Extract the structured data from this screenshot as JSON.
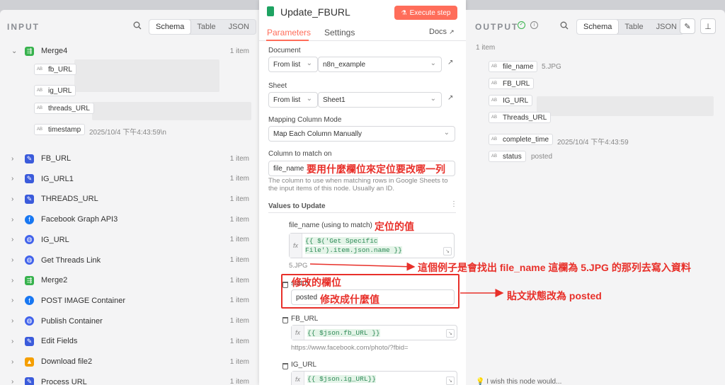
{
  "left": {
    "title": "INPUT",
    "tabs": [
      "Schema",
      "Table",
      "JSON"
    ],
    "merge4": {
      "label": "Merge4",
      "count": "1 item"
    },
    "fields": [
      {
        "name": "fb_URL",
        "value": ""
      },
      {
        "name": "ig_URL",
        "value": ""
      },
      {
        "name": "threads_URL",
        "value": ""
      },
      {
        "name": "timestamp",
        "value": "2025/10/4 下午4:43:59\\n"
      }
    ],
    "nodes": [
      {
        "label": "FB_URL",
        "count": "1 item",
        "icon": "pencil-icon",
        "color": "#3b5bdb"
      },
      {
        "label": "IG_URL1",
        "count": "1 item",
        "icon": "pencil-icon",
        "color": "#3b5bdb"
      },
      {
        "label": "THREADS_URL",
        "count": "1 item",
        "icon": "pencil-icon",
        "color": "#3b5bdb"
      },
      {
        "label": "Facebook Graph API3",
        "count": "1 item",
        "icon": "facebook-icon",
        "color": "#1877f2"
      },
      {
        "label": "IG_URL",
        "count": "1 item",
        "icon": "globe-icon",
        "color": "#4263eb"
      },
      {
        "label": "Get Threads Link",
        "count": "1 item",
        "icon": "globe-icon",
        "color": "#4263eb"
      },
      {
        "label": "Merge2",
        "count": "1 item",
        "icon": "merge-icon",
        "color": "#37b24d"
      },
      {
        "label": "POST IMAGE Container",
        "count": "1 item",
        "icon": "facebook-icon",
        "color": "#1877f2"
      },
      {
        "label": "Publish Container",
        "count": "1 item",
        "icon": "globe-icon",
        "color": "#4263eb"
      },
      {
        "label": "Edit Fields",
        "count": "1 item",
        "icon": "pencil-icon",
        "color": "#3b5bdb"
      },
      {
        "label": "Download file2",
        "count": "1 item",
        "icon": "google-drive-icon",
        "color": "#f59f00"
      },
      {
        "label": "Process URL",
        "count": "1 item",
        "icon": "pencil-icon",
        "color": "#3b5bdb"
      }
    ]
  },
  "center": {
    "title": "Update_FBURL",
    "execute_label": "Execute step",
    "tab_parameters": "Parameters",
    "tab_settings": "Settings",
    "docs_label": "Docs",
    "document_label": "Document",
    "document_mode": "From list",
    "document_value": "n8n_example",
    "sheet_label": "Sheet",
    "sheet_mode": "From list",
    "sheet_value": "Sheet1",
    "mapping_label": "Mapping Column Mode",
    "mapping_value": "Map Each Column Manually",
    "match_label": "Column to match on",
    "match_value": "file_name",
    "match_hint": "The column to use when matching rows in Google Sheets to the input items of this node. Usually an ID.",
    "values_label": "Values to Update",
    "file_name_label": "file_name (using to match)",
    "file_name_expr": "{{ $('Get Specific File').item.json.name }}",
    "file_name_result": "5.JPG",
    "status_label": "status",
    "status_value": "posted",
    "fb_label": "FB_URL",
    "fb_expr": "{{ $json.fb_URL }}",
    "fb_result": "https://www.facebook.com/photo/?fbid=",
    "ig_label": "IG_URL",
    "ig_expr": "{{ $json.ig_URL}}"
  },
  "annotations": {
    "match_note": "要用什麼欄位來定位要改哪一列",
    "locate_note": "定位的值",
    "example_note": "這個例子是會找出 file_name 這欄為 5.JPG 的那列去寫入資料",
    "status_note": "修改的欄位",
    "value_note": "修改成什麼值",
    "result_note": "貼文狀態改為 posted"
  },
  "right": {
    "title": "OUTPUT",
    "tabs": [
      "Schema",
      "Table",
      "JSON"
    ],
    "count": "1 item",
    "fields": [
      {
        "name": "file_name",
        "value": "5.JPG"
      },
      {
        "name": "FB_URL",
        "value": ""
      },
      {
        "name": "IG_URL",
        "value": ""
      },
      {
        "name": "Threads_URL",
        "value": ""
      },
      {
        "name": "complete_time",
        "value": "2025/10/4 下午4:43:59"
      },
      {
        "name": "status",
        "value": "posted"
      }
    ],
    "feedback": "I wish this node would..."
  },
  "colors": {
    "accent": "#ff6d5a",
    "annotation": "#e8302a",
    "success": "#37b24d"
  }
}
